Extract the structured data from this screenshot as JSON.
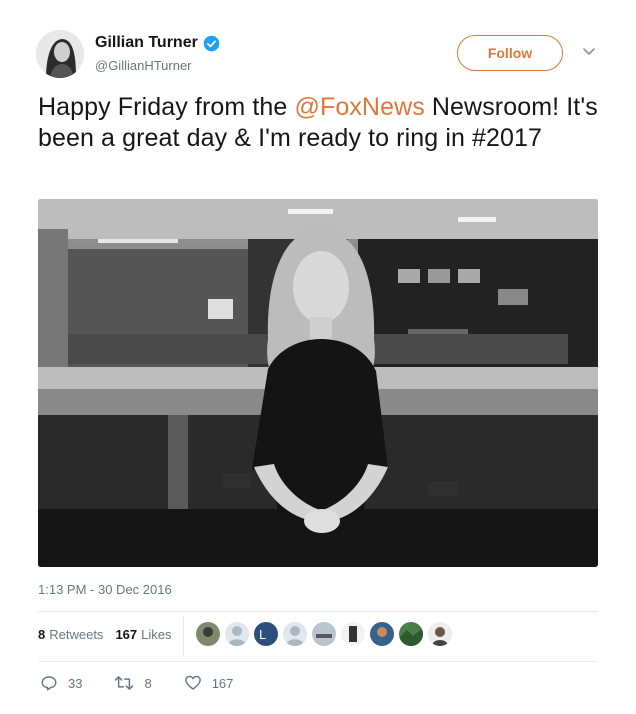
{
  "author": {
    "display_name": "Gillian Turner",
    "handle": "@GillianHTurner",
    "verified": true
  },
  "header": {
    "follow_label": "Follow",
    "menu_icon": "chevron-down-icon"
  },
  "tweet": {
    "text_before": "Happy Friday from the ",
    "mention": "@FoxNews",
    "text_after": " Newsroom! It's been a great day & I'm ready to ring in #2017",
    "timestamp": "1:13 PM - 30 Dec 2016"
  },
  "stats": {
    "retweets_count": "8",
    "retweets_label": "Retweets",
    "likes_count": "167",
    "likes_label": "Likes"
  },
  "actions": {
    "reply_count": "33",
    "retweet_count": "8",
    "like_count": "167"
  },
  "colors": {
    "accent": "#e0773a",
    "verified": "#1da1f2",
    "muted": "#657786",
    "divider": "#e6ecf0"
  }
}
